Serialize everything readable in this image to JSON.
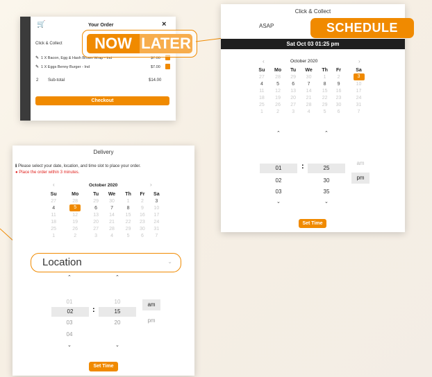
{
  "cart": {
    "title": "Your Order",
    "close": "×",
    "mode": "Click & Collect",
    "items": [
      {
        "name": "1 X Bacon, Egg & Hash Brown Wrap - Ind",
        "price": "$7.00"
      },
      {
        "name": "1 X Eggs Benny Burger - Ind",
        "price": "$7.00"
      }
    ],
    "subtotal_qty": "2",
    "subtotal_label": "Sub-total",
    "subtotal_value": "$14.00",
    "checkout": "Checkout"
  },
  "callout_now_later": {
    "now": "NOW",
    "later": "LATER"
  },
  "callout_schedule": "SCHEDULE",
  "callout_location": "Location",
  "click_collect": {
    "title": "Click & Collect",
    "tab_asap": "ASAP",
    "selected_banner": "Sat Oct 03 01:25 pm",
    "month": "October 2020",
    "weekdays": [
      "Su",
      "Mo",
      "Tu",
      "We",
      "Th",
      "Fr",
      "Sa"
    ],
    "weeks": [
      [
        "27",
        "28",
        "29",
        "30",
        "1",
        "2",
        "3"
      ],
      [
        "4",
        "5",
        "6",
        "7",
        "8",
        "9",
        "10"
      ],
      [
        "11",
        "12",
        "13",
        "14",
        "15",
        "16",
        "17"
      ],
      [
        "18",
        "19",
        "20",
        "21",
        "22",
        "23",
        "24"
      ],
      [
        "25",
        "26",
        "27",
        "28",
        "29",
        "30",
        "31"
      ],
      [
        "1",
        "2",
        "3",
        "4",
        "5",
        "6",
        "7"
      ]
    ],
    "hour_prev": "",
    "hour": "01",
    "hour_next": "02",
    "hour_next2": "03",
    "minute_prev": "",
    "minute": "25",
    "minute_next": "30",
    "minute_next2": "35",
    "am": "am",
    "pm": "pm",
    "set_time": "Set Time"
  },
  "delivery": {
    "title": "Delivery",
    "info": "Please select your date, location, and time slot to place your order.",
    "warning": "Place the order within 3 minutes.",
    "month": "October 2020",
    "weekdays": [
      "Su",
      "Mo",
      "Tu",
      "We",
      "Th",
      "Fr",
      "Sa"
    ],
    "weeks": [
      [
        "27",
        "28",
        "29",
        "30",
        "1",
        "2",
        "3"
      ],
      [
        "4",
        "5",
        "6",
        "7",
        "8",
        "9",
        "10"
      ],
      [
        "11",
        "12",
        "13",
        "14",
        "15",
        "16",
        "17"
      ],
      [
        "18",
        "19",
        "20",
        "21",
        "22",
        "23",
        "24"
      ],
      [
        "25",
        "26",
        "27",
        "28",
        "29",
        "30",
        "31"
      ],
      [
        "1",
        "2",
        "3",
        "4",
        "5",
        "6",
        "7"
      ]
    ],
    "hour_prev": "01",
    "hour": "02",
    "hour_next": "03",
    "hour_next2": "04",
    "minute_prev": "10",
    "minute": "15",
    "minute_next": "20",
    "am": "am",
    "pm": "pm",
    "set_time": "Set Time"
  },
  "colors": {
    "accent": "#f08a00",
    "dark_banner": "#1f1f1f"
  }
}
